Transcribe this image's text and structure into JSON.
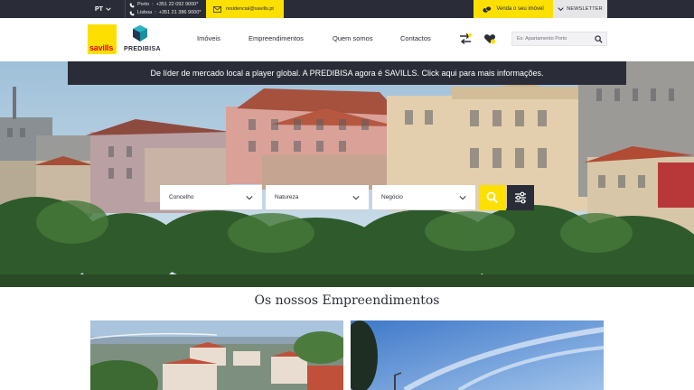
{
  "topbar": {
    "language": "PT",
    "phones": [
      {
        "city": "Porto",
        "number": "+351 22 092 9000*"
      },
      {
        "city": "Lisboa",
        "number": "+351 21 386 9000*"
      }
    ],
    "email": "residencial@savills.pt",
    "sell_label": "Venda o seu imóvel",
    "newsletter_label": "NEWSLETTER"
  },
  "header": {
    "logo_savills": "savills",
    "logo_predibisa": "PREDIBISA",
    "nav": [
      "Imóveis",
      "Empreendimentos",
      "Quem somos",
      "Contactos"
    ],
    "search_placeholder": "Ex: Apartamento Porto"
  },
  "hero": {
    "banner": "De líder de mercado local a player global. A PREDIBISA agora é SAVILLS. Click aqui para mais informações.",
    "filters": [
      "Concelho",
      "Natureza",
      "Negócio"
    ]
  },
  "main": {
    "section_title": "Os nossos Empreendimentos"
  },
  "colors": {
    "brand_yellow": "#fde000",
    "dark_navy": "#2a2d38",
    "savills_red": "#e3001b"
  }
}
